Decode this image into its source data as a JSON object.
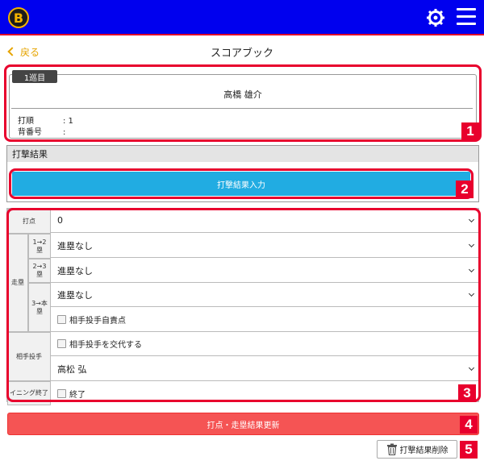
{
  "app": {
    "logo_letter": "B"
  },
  "nav": {
    "back_label": "戻る",
    "page_title": "スコアブック"
  },
  "player": {
    "round_label": "1巡目",
    "name": "高橋 雄介",
    "batting_order_label": "打順",
    "batting_order_value": ": 1",
    "uniform_number_label": "背番号",
    "uniform_number_value": ":"
  },
  "batting_result": {
    "section_title": "打撃結果",
    "input_button_label": "打撃結果入力"
  },
  "form": {
    "rbi_label": "打点",
    "rbi_value": "0",
    "runner_label": "走塁",
    "runner_1to2_label": "1→2",
    "runner_2to3_label": "2→3",
    "runner_3tohome_label": "3→本",
    "runner_icon_label": "塁",
    "runner_1to2_value": "進塁なし",
    "runner_2to3_value": "進塁なし",
    "runner_3tohome_value": "進塁なし",
    "opponent_error_label": "相手投手自責点",
    "opponent_pitcher_label": "相手投手",
    "change_pitcher_label": "相手投手を交代する",
    "pitcher_name": "高松 弘",
    "inning_end_label": "イニング終了",
    "inning_end_check_label": "終了"
  },
  "actions": {
    "update_button_label": "打点・走塁結果更新",
    "delete_button_label": "打撃結果削除"
  },
  "callouts": [
    "1",
    "2",
    "3",
    "4",
    "5"
  ],
  "colors": {
    "header_blue": "#0000ee",
    "accent_red": "#e8002d",
    "input_blue": "#21ace2",
    "update_red": "#f55454",
    "back_orange": "#e6a400"
  }
}
